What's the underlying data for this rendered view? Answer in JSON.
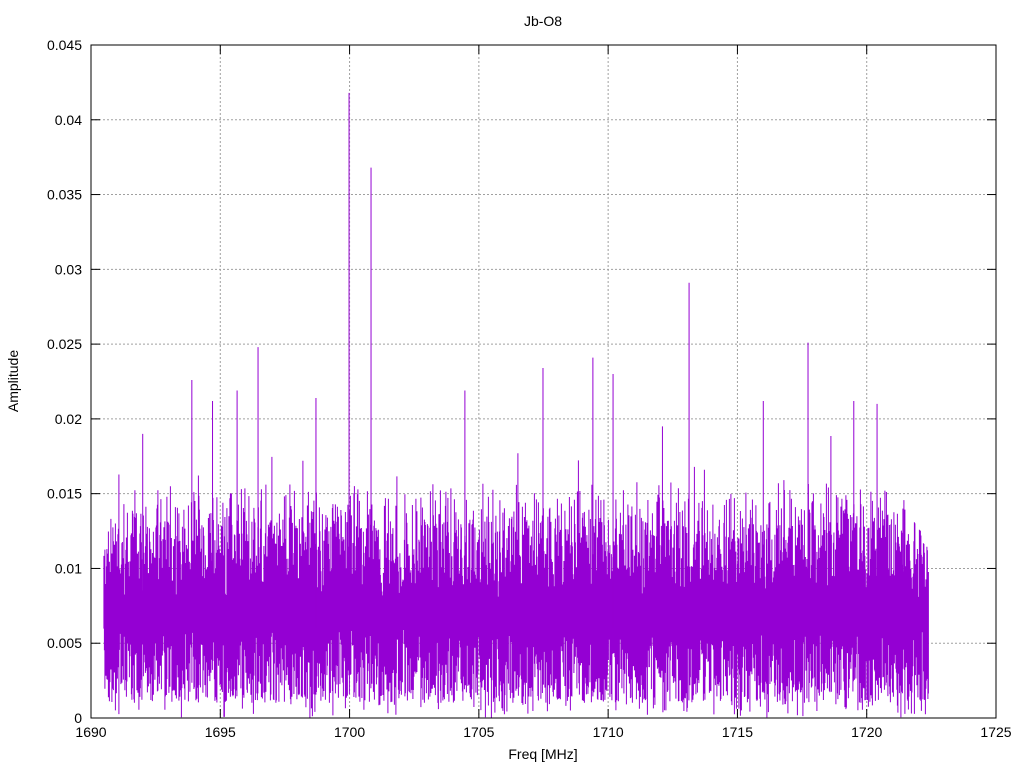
{
  "chart_data": {
    "type": "line",
    "title": "Jb-O8",
    "xlabel": "Freq [MHz]",
    "ylabel": "Amplitude",
    "xlim": [
      1690,
      1725
    ],
    "ylim": [
      0,
      0.045
    ],
    "xticks": [
      "1690",
      "1695",
      "1700",
      "1705",
      "1710",
      "1715",
      "1720",
      "1725"
    ],
    "yticks": [
      "0",
      "0.005",
      "0.01",
      "0.015",
      "0.02",
      "0.025",
      "0.03",
      "0.035",
      "0.04",
      "0.045"
    ],
    "grid": true,
    "series_color": "#9400d3",
    "series": [
      {
        "name": "Jb-O8",
        "x_range": [
          1690.5,
          1722.4
        ],
        "typical_max": 0.016,
        "typical_mean": 0.008,
        "typical_min": 0.001,
        "peaks": [
          {
            "x": 1699.98,
            "y": 0.0418
          },
          {
            "x": 1700.83,
            "y": 0.0368
          },
          {
            "x": 1713.13,
            "y": 0.0291
          },
          {
            "x": 1717.73,
            "y": 0.0251
          },
          {
            "x": 1696.46,
            "y": 0.0248
          },
          {
            "x": 1709.41,
            "y": 0.0241
          },
          {
            "x": 1707.48,
            "y": 0.0234
          },
          {
            "x": 1710.19,
            "y": 0.023
          },
          {
            "x": 1693.9,
            "y": 0.0226
          },
          {
            "x": 1695.65,
            "y": 0.0219
          },
          {
            "x": 1704.46,
            "y": 0.0219
          },
          {
            "x": 1698.7,
            "y": 0.0214
          },
          {
            "x": 1694.7,
            "y": 0.0212
          },
          {
            "x": 1716.0,
            "y": 0.0212
          },
          {
            "x": 1719.5,
            "y": 0.0212
          },
          {
            "x": 1720.4,
            "y": 0.021
          },
          {
            "x": 1692.0,
            "y": 0.019
          },
          {
            "x": 1712.1,
            "y": 0.0195
          },
          {
            "x": 1721.4,
            "y": 0.014
          },
          {
            "x": 1722.1,
            "y": 0.011
          }
        ]
      }
    ]
  }
}
